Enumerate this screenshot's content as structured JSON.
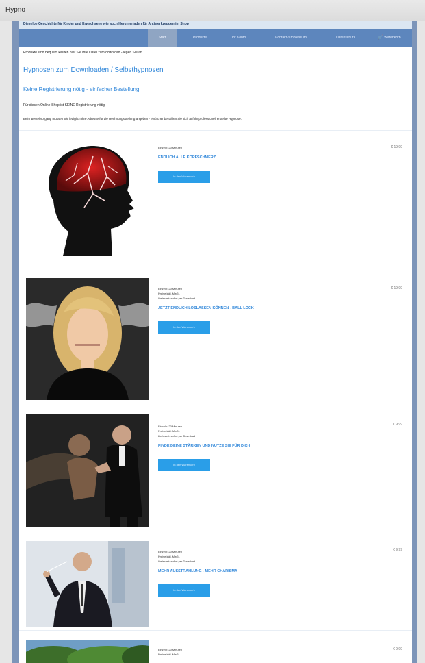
{
  "window": {
    "title": "Hypno"
  },
  "top_strip": {
    "text": "Dieselbe Geschichte für Kinder und Erwachsene wie auch Herunterladen für Antiwerkzeugen im Shop"
  },
  "nav": {
    "items": [
      {
        "label": "Start",
        "active": true
      },
      {
        "label": "Produkte"
      },
      {
        "label": "Ihr Konto"
      },
      {
        "label": "Kontakt / Impressum"
      },
      {
        "label": "Datenschutz"
      },
      {
        "label": "Warenkorb"
      }
    ]
  },
  "intro": {
    "line1": "Produkte sind bequem kaufen hier Sie Ihre Datei zum download - legen Sie an.",
    "heading": "Hypnosen zum Downloaden / Selbsthypnosen",
    "subheading": "Keine Registrierung nötig - einfacher Bestellung",
    "p1": "Für diesen Online-Shop ist KEINE Registrierung nötig.",
    "p2": "Beim Bestellvorgang müssen Sie lediglich Ihre Adresse für die Rechnungsstellung angeben - einfacher bezahlen Sie sich auf Ihr professionell erstellte Hypnose."
  },
  "products": [
    {
      "lines": [
        "Einzeln: 20 Minuten"
      ],
      "title": "ENDLICH ALLE KOPFSCHMERZ",
      "price": "€ 19,99",
      "button": "In den Warenkorb"
    },
    {
      "lines": [
        "Einzeln: 20 Minuten",
        "Preise inkl. MwSt.",
        "Lieferzeit: sofort per Download"
      ],
      "title": "JETZT ENDLICH LOSLASSEN KÖNNEN - BALL LOCK",
      "price": "€ 19,99",
      "button": "In den Warenkorb"
    },
    {
      "lines": [
        "Einzeln: 20 Minuten",
        "Preise inkl. MwSt.",
        "Lieferzeit: sofort per Download"
      ],
      "title": "FINDE DEINE STÄRKEN UND NUTZE SIE FÜR DICH",
      "price": "€ 9,99",
      "button": "In den Warenkorb"
    },
    {
      "lines": [
        "Einzeln: 20 Minuten",
        "Preise inkl. MwSt.",
        "Lieferzeit: sofort per Download"
      ],
      "title": "MEHR AUSSTRAHLUNG - MEHR CHARISMA",
      "price": "€ 9,99",
      "button": "In den Warenkorb"
    },
    {
      "lines": [
        "Einzeln: 20 Minuten",
        "Preise inkl. MwSt."
      ],
      "title": "",
      "price": "€ 9,99",
      "button": ""
    }
  ]
}
